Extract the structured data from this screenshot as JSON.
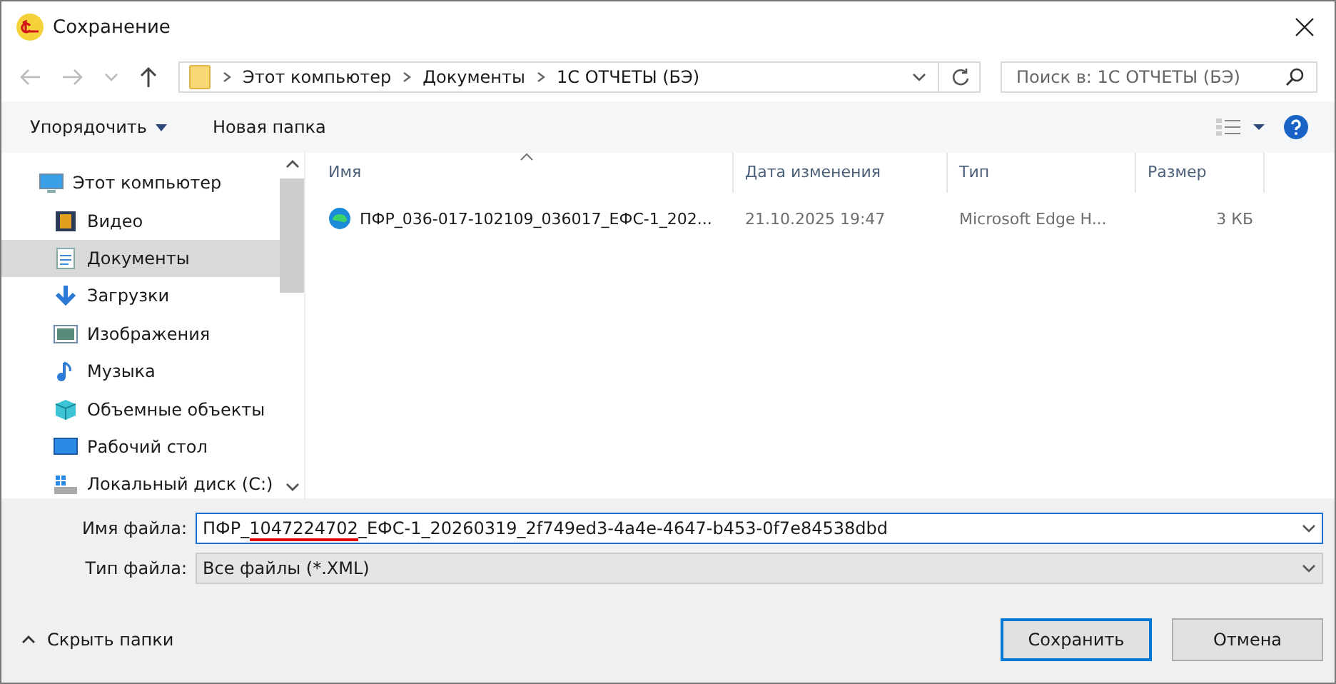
{
  "window": {
    "title": "Сохранение"
  },
  "breadcrumb": [
    "Этот компьютер",
    "Документы",
    "1С ОТЧЕТЫ (БЭ)"
  ],
  "search": {
    "placeholder": "Поиск в: 1С ОТЧЕТЫ (БЭ)"
  },
  "toolbar": {
    "organize": "Упорядочить",
    "new_folder": "Новая папка"
  },
  "sidebar": {
    "items": [
      {
        "label": "Этот компьютер",
        "kind": "computer",
        "selected": false,
        "children": [
          {
            "label": "Видео",
            "kind": "video",
            "selected": false
          },
          {
            "label": "Документы",
            "kind": "documents",
            "selected": true
          },
          {
            "label": "Загрузки",
            "kind": "downloads",
            "selected": false
          },
          {
            "label": "Изображения",
            "kind": "pictures",
            "selected": false
          },
          {
            "label": "Музыка",
            "kind": "music",
            "selected": false
          },
          {
            "label": "Объемные объекты",
            "kind": "objects",
            "selected": false
          },
          {
            "label": "Рабочий стол",
            "kind": "desktop",
            "selected": false
          },
          {
            "label": "Локальный диск (C:)",
            "kind": "disk",
            "selected": false
          }
        ]
      }
    ]
  },
  "table": {
    "columns": [
      "Имя",
      "Дата изменения",
      "Тип",
      "Размер"
    ],
    "rows": [
      {
        "name": "ПФР_036-017-102109_036017_ЕФС-1_202...",
        "date": "21.10.2025 19:47",
        "type": "Microsoft Edge H...",
        "size": "3 КБ",
        "selected": false
      }
    ]
  },
  "file_name": {
    "label": "Имя файла:",
    "value_parts": [
      {
        "text": "ПФР_",
        "underlined": false
      },
      {
        "text": "1047224702",
        "underlined": true,
        "color": "#e00000"
      },
      {
        "text": "_ЕФС-1_20260319_2f749ed3-4a4e-4647-b453-0f7e84538dbd",
        "underlined": false
      }
    ]
  },
  "file_type": {
    "label": "Тип файла:",
    "value": "Все файлы (*.XML)"
  },
  "hide_folders": "Скрыть папки",
  "buttons": [
    {
      "label": "Сохранить",
      "default": true
    },
    {
      "label": "Отмена",
      "default": false
    }
  ]
}
